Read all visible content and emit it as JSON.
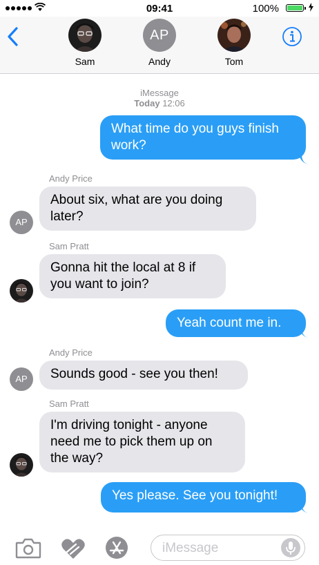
{
  "status": {
    "time": "09:41",
    "battery": "100%"
  },
  "header": {
    "contacts": [
      {
        "name": "Sam"
      },
      {
        "name": "Andy",
        "initials": "AP"
      },
      {
        "name": "Tom"
      }
    ]
  },
  "thread": {
    "service": "iMessage",
    "day": "Today",
    "time": "12:06"
  },
  "messages": [
    {
      "direction": "outgoing",
      "text": "What time do you guys finish\nwork?"
    },
    {
      "direction": "incoming",
      "sender": "Andy Price",
      "initials": "AP",
      "text": "About six, what are you doing\nlater?"
    },
    {
      "direction": "incoming",
      "sender": "Sam Pratt",
      "text": "Gonna hit the local at 8 if\nyou want to join?"
    },
    {
      "direction": "outgoing",
      "text": "Yeah count me in."
    },
    {
      "direction": "incoming",
      "sender": "Andy Price",
      "initials": "AP",
      "text": "Sounds good - see you then!"
    },
    {
      "direction": "incoming",
      "sender": "Sam Pratt",
      "text": "I'm driving tonight - anyone\nneed me to pick them up on\nthe way?"
    },
    {
      "direction": "outgoing",
      "text": "Yes please. See you tonight!"
    }
  ],
  "composer": {
    "placeholder": "iMessage"
  },
  "colors": {
    "accent": "#2a9ef6",
    "incoming_bubble": "#e5e5ea",
    "ios_blue": "#147efb"
  }
}
